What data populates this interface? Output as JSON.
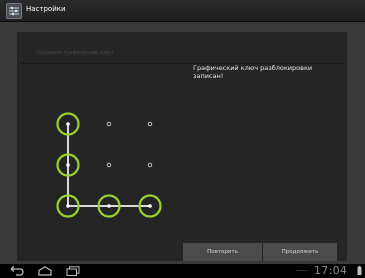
{
  "app": {
    "title": "Настройки",
    "icon": "settings-sliders-icon"
  },
  "panel": {
    "heading": "Создайте графический ключ",
    "status": "Графический ключ разблокировки записан!"
  },
  "pattern": {
    "grid": "3x3",
    "selected_dots": [
      1,
      4,
      7,
      8,
      9
    ],
    "accent_color": "#9cd12f",
    "line_color": "#d9d9d9"
  },
  "buttons": {
    "retry": "Повторить",
    "continue": "Продолжить"
  },
  "navbar": {
    "back_icon": "back-icon",
    "home_icon": "home-icon",
    "recent_icon": "recent-apps-icon",
    "clock": "17:04",
    "battery_icon": "battery-icon"
  }
}
